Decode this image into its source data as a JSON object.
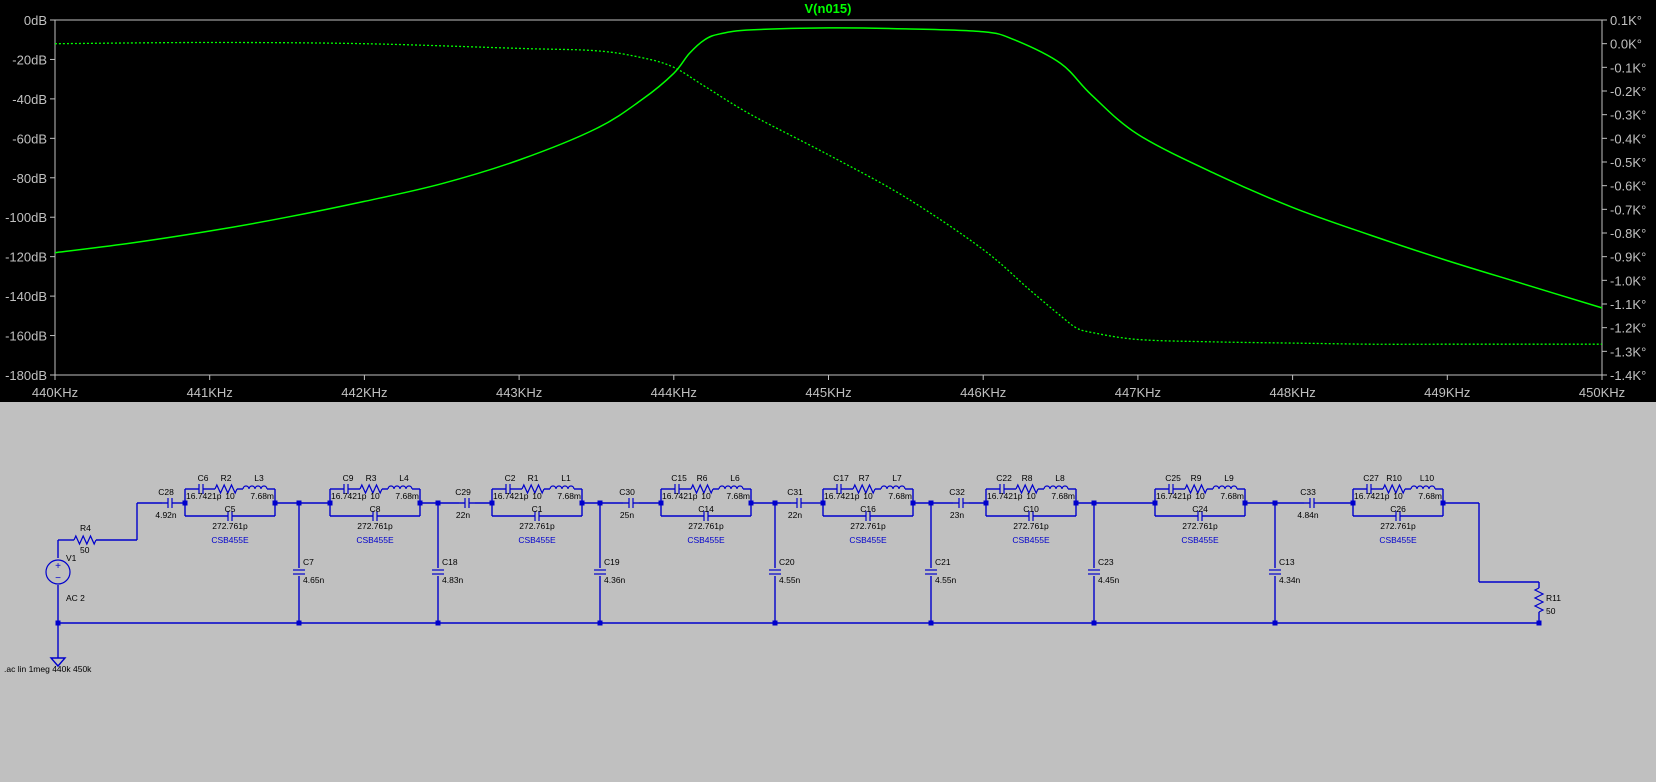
{
  "plot": {
    "trace_title": "V(n015)",
    "colors": {
      "background": "#000000",
      "axis": "#c0c0c0",
      "trace": "#00ff00"
    },
    "chart_data": {
      "type": "line",
      "title": "V(n015)",
      "x_ticks": [
        "440KHz",
        "441KHz",
        "442KHz",
        "443KHz",
        "444KHz",
        "445KHz",
        "446KHz",
        "447KHz",
        "448KHz",
        "449KHz",
        "450KHz"
      ],
      "y_left_ticks": [
        "0dB",
        "-20dB",
        "-40dB",
        "-60dB",
        "-80dB",
        "-100dB",
        "-120dB",
        "-140dB",
        "-160dB",
        "-180dB"
      ],
      "y_right_ticks": [
        "0.1K°",
        "0.0K°",
        "-0.1K°",
        "-0.2K°",
        "-0.3K°",
        "-0.4K°",
        "-0.5K°",
        "-0.6K°",
        "-0.7K°",
        "-0.8K°",
        "-0.9K°",
        "-1.0K°",
        "-1.1K°",
        "-1.2K°",
        "-1.3K°",
        "-1.4K°"
      ],
      "xlim": [
        440,
        450
      ],
      "ylim_left": [
        -180,
        0
      ],
      "ylim_right": [
        -1.4,
        0.1
      ],
      "grid": false,
      "series": [
        {
          "style": "solid",
          "axis": "left",
          "x_khz": [
            440,
            440.5,
            441,
            441.5,
            442,
            442.5,
            443,
            443.5,
            443.8,
            444,
            444.1,
            444.2,
            444.3,
            444.5,
            445,
            445.5,
            446,
            446.2,
            446.5,
            446.7,
            447,
            447.5,
            448,
            448.5,
            449,
            449.5,
            450
          ],
          "y_db": [
            -118,
            -113,
            -107,
            -100,
            -92,
            -83,
            -71,
            -55,
            -40,
            -27,
            -17,
            -10,
            -7,
            -5,
            -4,
            -4.5,
            -6,
            -10,
            -22,
            -38,
            -58,
            -78,
            -95,
            -109,
            -122,
            -134,
            -146
          ]
        },
        {
          "style": "dotted",
          "axis": "right",
          "x_khz": [
            440,
            441,
            442,
            443,
            443.5,
            443.8,
            444,
            444.2,
            444.5,
            445,
            445.5,
            446,
            446.3,
            446.5,
            446.6,
            446.7,
            447,
            447.5,
            448,
            448.5,
            449,
            449.5,
            450
          ],
          "y_kdeg": [
            0.0,
            0.005,
            0.0,
            -0.02,
            -0.03,
            -0.06,
            -0.1,
            -0.18,
            -0.3,
            -0.47,
            -0.65,
            -0.87,
            -1.04,
            -1.15,
            -1.2,
            -1.22,
            -1.25,
            -1.26,
            -1.265,
            -1.27,
            -1.27,
            -1.27,
            -1.27
          ]
        }
      ]
    }
  },
  "schematic": {
    "colors": {
      "background": "#c0c0c0",
      "wire": "#0000cc",
      "text": "#000000",
      "model_text": "#0000cc"
    },
    "source": {
      "name": "V1",
      "value": "AC 2"
    },
    "source_resistor": {
      "name": "R4",
      "value": "50"
    },
    "load_resistor": {
      "name": "R11",
      "value": "50"
    },
    "directive": ".ac lin 1meg 440k 450k",
    "series_caps": [
      {
        "name": "C28",
        "value": "4.92n"
      },
      {
        "name": "C29",
        "value": "22n"
      },
      {
        "name": "C30",
        "value": "25n"
      },
      {
        "name": "C31",
        "value": "22n"
      },
      {
        "name": "C32",
        "value": "23n"
      },
      {
        "name": "C33",
        "value": "4.84n"
      }
    ],
    "shunt_caps": [
      {
        "name": "C7",
        "value": "4.65n"
      },
      {
        "name": "C18",
        "value": "4.83n"
      },
      {
        "name": "C19",
        "value": "4.36n"
      },
      {
        "name": "C20",
        "value": "4.55n"
      },
      {
        "name": "C21",
        "value": "4.55n"
      },
      {
        "name": "C23",
        "value": "4.45n"
      },
      {
        "name": "C13",
        "value": "4.34n"
      }
    ],
    "resonators": [
      {
        "c_name": "C6",
        "c_value": "16.7421p",
        "r_name": "R2",
        "r_value": "10",
        "l_name": "L3",
        "l_value": "7.68m",
        "cp_name": "C5",
        "cp_value": "272.761p",
        "model": "CSB455E"
      },
      {
        "c_name": "C9",
        "c_value": "16.7421p",
        "r_name": "R3",
        "r_value": "10",
        "l_name": "L4",
        "l_value": "7.68m",
        "cp_name": "C8",
        "cp_value": "272.761p",
        "model": "CSB455E"
      },
      {
        "c_name": "C2",
        "c_value": "16.7421p",
        "r_name": "R1",
        "r_value": "10",
        "l_name": "L1",
        "l_value": "7.68m",
        "cp_name": "C1",
        "cp_value": "272.761p",
        "model": "CSB455E"
      },
      {
        "c_name": "C15",
        "c_value": "16.7421p",
        "r_name": "R6",
        "r_value": "10",
        "l_name": "L6",
        "l_value": "7.68m",
        "cp_name": "C14",
        "cp_value": "272.761p",
        "model": "CSB455E"
      },
      {
        "c_name": "C17",
        "c_value": "16.7421p",
        "r_name": "R7",
        "r_value": "10",
        "l_name": "L7",
        "l_value": "7.68m",
        "cp_name": "C16",
        "cp_value": "272.761p",
        "model": "CSB455E"
      },
      {
        "c_name": "C22",
        "c_value": "16.7421p",
        "r_name": "R8",
        "r_value": "10",
        "l_name": "L8",
        "l_value": "7.68m",
        "cp_name": "C10",
        "cp_value": "272.761p",
        "model": "CSB455E"
      },
      {
        "c_name": "C25",
        "c_value": "16.7421p",
        "r_name": "R9",
        "r_value": "10",
        "l_name": "L9",
        "l_value": "7.68m",
        "cp_name": "C24",
        "cp_value": "272.761p",
        "model": "CSB455E"
      },
      {
        "c_name": "C27",
        "c_value": "16.7421p",
        "r_name": "R10",
        "r_value": "10",
        "l_name": "L10",
        "l_value": "7.68m",
        "cp_name": "C26",
        "cp_value": "272.761p",
        "model": "CSB455E"
      }
    ]
  }
}
